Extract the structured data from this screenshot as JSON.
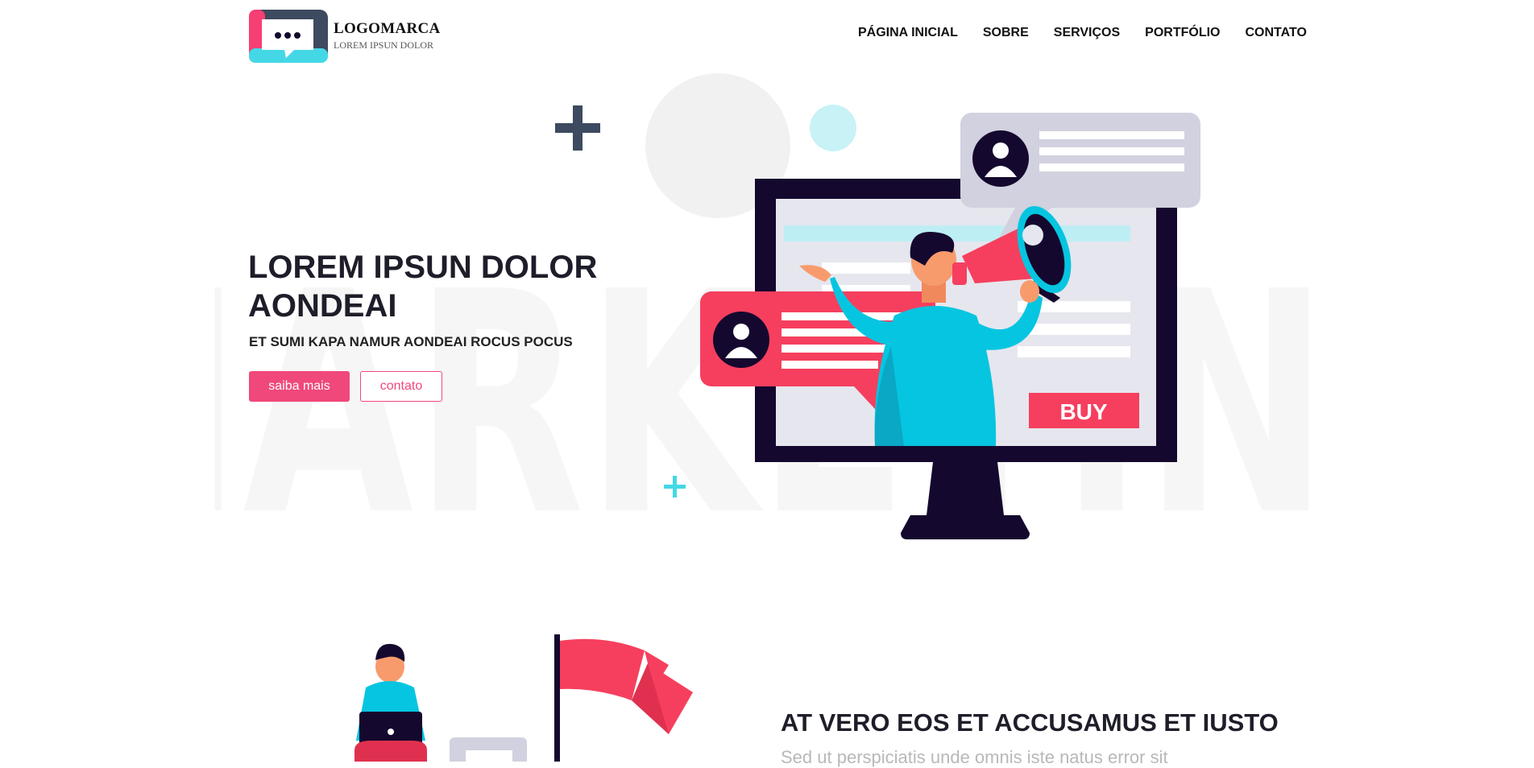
{
  "logo": {
    "title": "LOGOMARCA",
    "subtitle": "LOREM IPSUN DOLOR"
  },
  "nav": [
    {
      "label": "PÁGINA INICIAL"
    },
    {
      "label": "SOBRE"
    },
    {
      "label": "SERVIÇOS"
    },
    {
      "label": "PORTFÓLIO"
    },
    {
      "label": "CONTATO"
    }
  ],
  "watermark": "MARKETING",
  "hero": {
    "title": "LOREM IPSUN DOLOR AONDEAI",
    "subtitle": "ET SUMI KAPA NAMUR AONDEAI ROCUS POCUS",
    "primary_button": "saiba mais",
    "secondary_button": "contato"
  },
  "illustration": {
    "buy_label": "BUY"
  },
  "section2": {
    "title": "AT VERO EOS ET ACCUSAMUS ET IUSTO",
    "subtitle": "Sed ut perspiciatis unde omnis iste natus error sit"
  },
  "colors": {
    "accent": "#f0487a",
    "navy": "#15082e",
    "cyan": "#06c5e0",
    "slate": "#34495e"
  }
}
